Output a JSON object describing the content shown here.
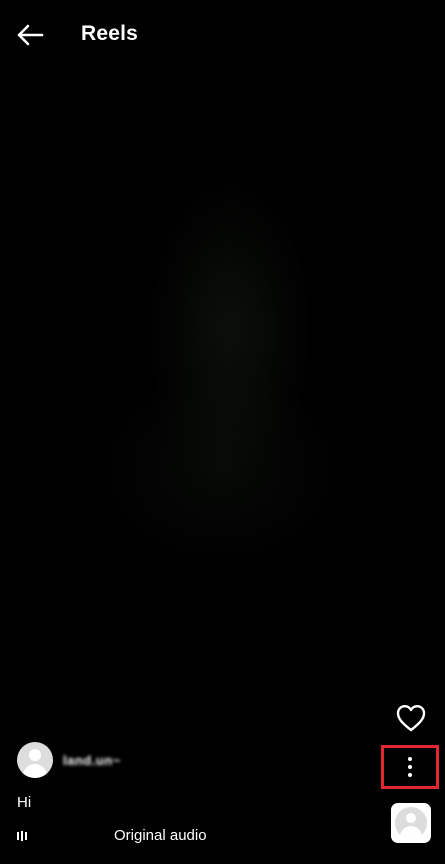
{
  "header": {
    "title": "Reels",
    "back_icon": "arrow-left-icon"
  },
  "reel": {
    "author": {
      "username": "land.un~",
      "avatar_icon": "default-avatar-icon"
    },
    "caption": "Hi",
    "audio": {
      "label": "Original audio",
      "icon": "audio-bars-icon"
    }
  },
  "actions": {
    "like_icon": "heart-outline-icon",
    "more_icon": "more-vertical-icon",
    "highlight_color": "#e3262f",
    "audio_thumb_icon": "default-avatar-icon"
  },
  "colors": {
    "background": "#000000",
    "text": "#ffffff"
  }
}
